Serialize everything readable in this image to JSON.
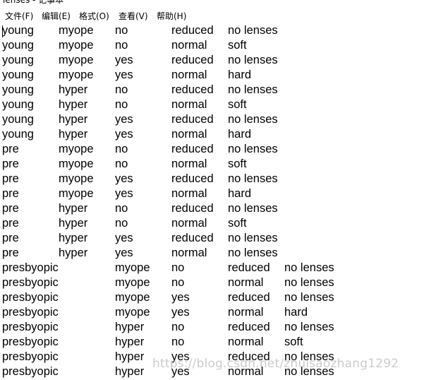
{
  "window": {
    "title": "lenses - 记事本"
  },
  "menu": {
    "items": [
      {
        "label": "文件(F)"
      },
      {
        "label": "编辑(E)"
      },
      {
        "label": "格式(O)"
      },
      {
        "label": "查看(V)"
      },
      {
        "label": "帮助(H)"
      }
    ]
  },
  "document": {
    "rows": [
      [
        "young",
        "myope",
        "no",
        "reduced",
        "no lenses"
      ],
      [
        "young",
        "myope",
        "no",
        "normal",
        "soft"
      ],
      [
        "young",
        "myope",
        "yes",
        "reduced",
        "no lenses"
      ],
      [
        "young",
        "myope",
        "yes",
        "normal",
        "hard"
      ],
      [
        "young",
        "hyper",
        "no",
        "reduced",
        "no lenses"
      ],
      [
        "young",
        "hyper",
        "no",
        "normal",
        "soft"
      ],
      [
        "young",
        "hyper",
        "yes",
        "reduced",
        "no lenses"
      ],
      [
        "young",
        "hyper",
        "yes",
        "normal",
        "hard"
      ],
      [
        "pre",
        "myope",
        "no",
        "reduced",
        "no lenses"
      ],
      [
        "pre",
        "myope",
        "no",
        "normal",
        "soft"
      ],
      [
        "pre",
        "myope",
        "yes",
        "reduced",
        "no lenses"
      ],
      [
        "pre",
        "myope",
        "yes",
        "normal",
        "hard"
      ],
      [
        "pre",
        "hyper",
        "no",
        "reduced",
        "no lenses"
      ],
      [
        "pre",
        "hyper",
        "no",
        "normal",
        "soft"
      ],
      [
        "pre",
        "hyper",
        "yes",
        "reduced",
        "no lenses"
      ],
      [
        "pre",
        "hyper",
        "yes",
        "normal",
        "no lenses"
      ],
      [
        "presbyopic",
        "",
        "myope",
        "no",
        "reduced",
        "no lenses"
      ],
      [
        "presbyopic",
        "",
        "myope",
        "no",
        "normal",
        "no lenses"
      ],
      [
        "presbyopic",
        "",
        "myope",
        "yes",
        "reduced",
        "no lenses"
      ],
      [
        "presbyopic",
        "",
        "myope",
        "yes",
        "normal",
        "hard"
      ],
      [
        "presbyopic",
        "",
        "hyper",
        "no",
        "reduced",
        "no lenses"
      ],
      [
        "presbyopic",
        "",
        "hyper",
        "no",
        "normal",
        "soft"
      ],
      [
        "presbyopic",
        "",
        "hyper",
        "yes",
        "reduced",
        "no lenses"
      ],
      [
        "presbyopic",
        "",
        "hyper",
        "yes",
        "normal",
        "no lenses"
      ]
    ]
  },
  "watermark": {
    "text": "https://blog.csdn.net/zhuisaozhang1292"
  }
}
